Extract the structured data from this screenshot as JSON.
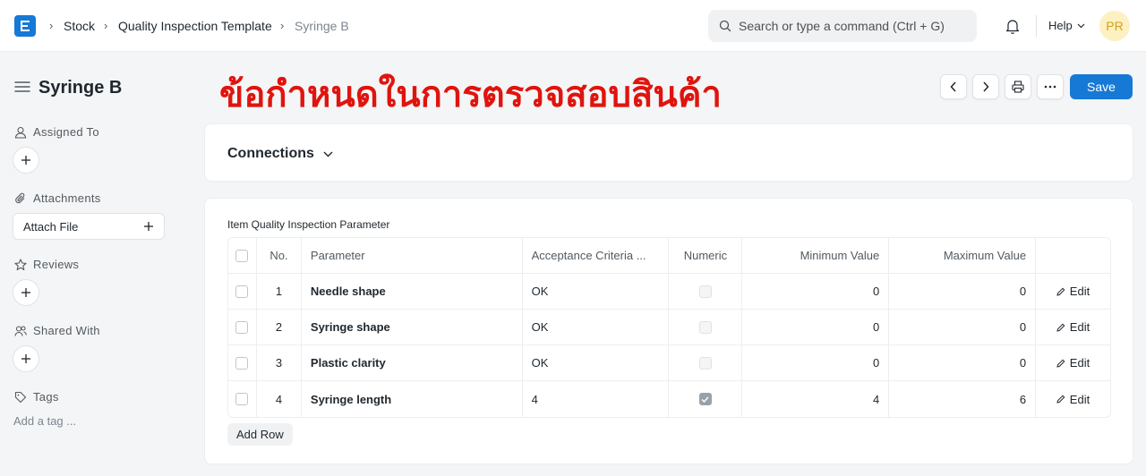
{
  "navbar": {
    "breadcrumbs": [
      "Stock",
      "Quality Inspection Template",
      "Syringe B"
    ],
    "search_placeholder": "Search or type a command (Ctrl + G)",
    "help_label": "Help",
    "avatar_initials": "PR"
  },
  "page": {
    "title": "Syringe B",
    "overlay_heading": "ข้อกำหนดในการตรวจสอบสินค้า",
    "save_label": "Save"
  },
  "sidebar": {
    "assigned_to": "Assigned To",
    "attachments": "Attachments",
    "attach_file": "Attach File",
    "reviews": "Reviews",
    "shared_with": "Shared With",
    "tags": "Tags",
    "add_tag": "Add a tag ..."
  },
  "connections": {
    "title": "Connections"
  },
  "parameters": {
    "label": "Item Quality Inspection Parameter",
    "columns": [
      "No.",
      "Parameter",
      "Acceptance Criteria ...",
      "Numeric",
      "Minimum Value",
      "Maximum Value"
    ],
    "rows": [
      {
        "no": "1",
        "parameter": "Needle shape",
        "criteria": "OK",
        "numeric": false,
        "min": "0",
        "max": "0"
      },
      {
        "no": "2",
        "parameter": "Syringe shape",
        "criteria": "OK",
        "numeric": false,
        "min": "0",
        "max": "0"
      },
      {
        "no": "3",
        "parameter": "Plastic clarity",
        "criteria": "OK",
        "numeric": false,
        "min": "0",
        "max": "0"
      },
      {
        "no": "4",
        "parameter": "Syringe length",
        "criteria": "4",
        "numeric": true,
        "min": "4",
        "max": "6"
      }
    ],
    "edit_label": "Edit",
    "add_row_label": "Add Row"
  },
  "colors": {
    "accent": "#1779d6",
    "heading_red": "#e0140e"
  }
}
